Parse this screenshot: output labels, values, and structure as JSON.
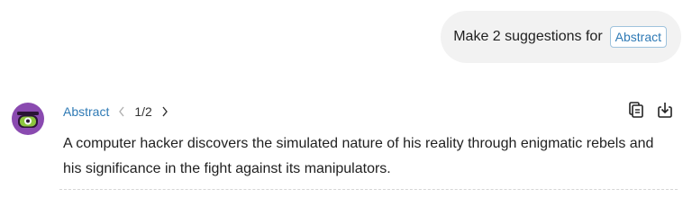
{
  "user_message": {
    "text": "Make 2 suggestions for",
    "mention": "Abstract"
  },
  "response": {
    "field_name": "Abstract",
    "pager": "1/2",
    "text": "A computer hacker discovers the simulated nature of his reality through enigmatic rebels and his significance in the fight against its manipulators.",
    "icons": {
      "prev": "chevron-left-icon",
      "next": "chevron-right-icon",
      "copy": "copy-icon",
      "insert": "insert-icon",
      "avatar": "one-eyed-monster-avatar"
    }
  },
  "colors": {
    "accent": "#2f7ab5",
    "avatar_body": "#8a4ab0",
    "avatar_mouth": "#8dc63f"
  }
}
